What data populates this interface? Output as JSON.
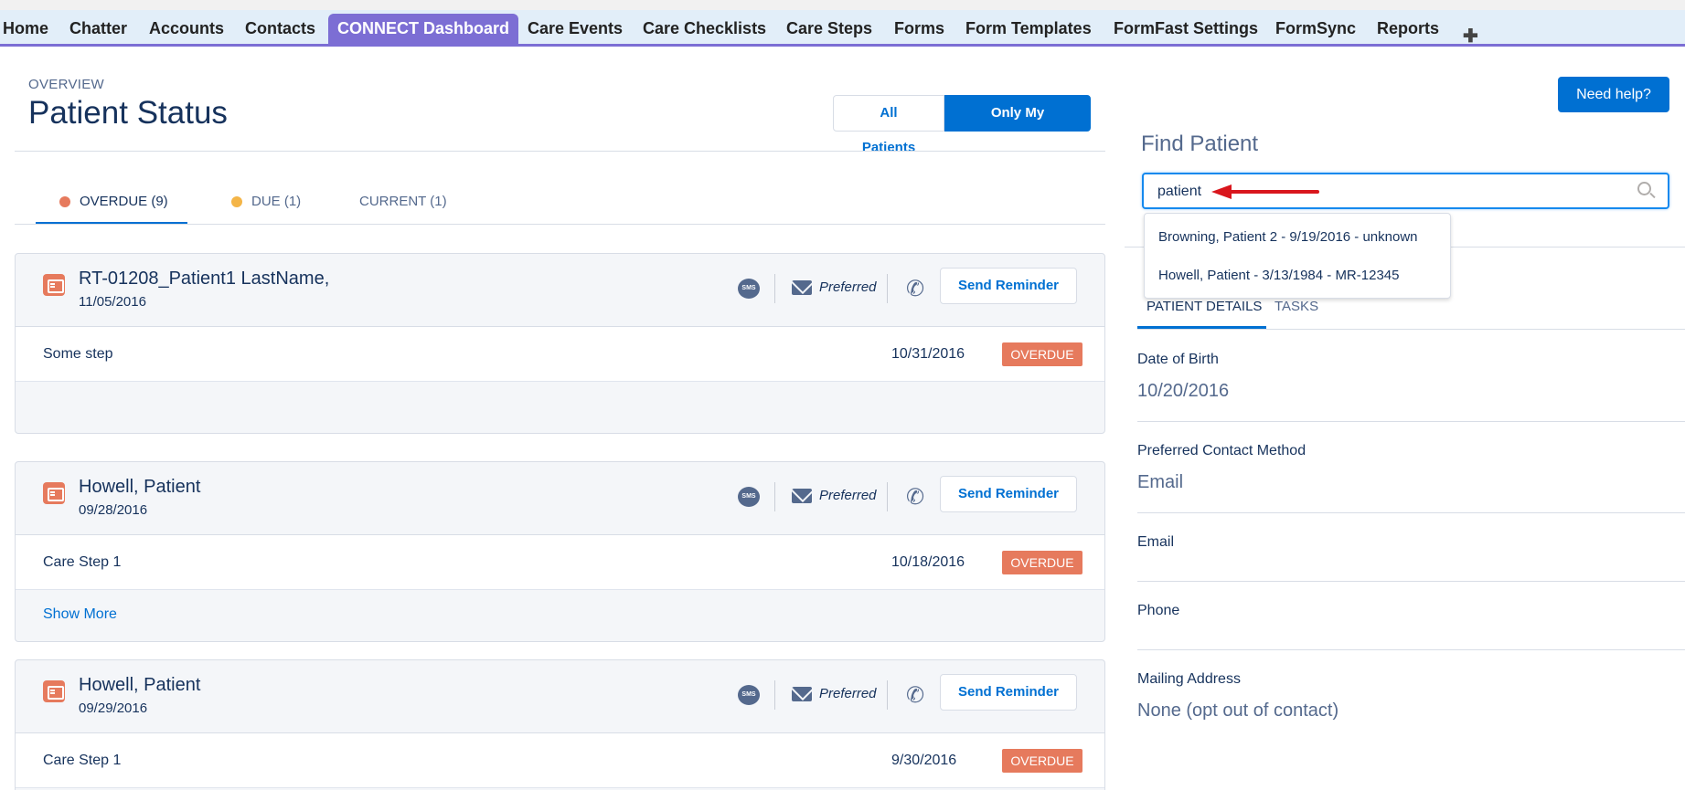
{
  "nav": {
    "tabs": [
      "Home",
      "Chatter",
      "Accounts",
      "Contacts",
      "CONNECT Dashboard",
      "Care Events",
      "Care Checklists",
      "Care Steps",
      "Forms",
      "Form Templates",
      "FormFast Settings",
      "FormSync",
      "Reports"
    ],
    "active_tab": "CONNECT Dashboard",
    "plus_icon": "plus-icon"
  },
  "header": {
    "eyebrow": "OVERVIEW",
    "title": "Patient Status",
    "filter_all": "All Patients",
    "filter_mine": "Only My Patients",
    "filter_active": "Only My Patients"
  },
  "status_tabs": {
    "overdue": "OVERDUE (9)",
    "due": "DUE (1)",
    "current": "CURRENT (1)"
  },
  "cards": [
    {
      "name": "RT-01208_Patient1 LastName,",
      "date": "11/05/2016",
      "preferred": "Preferred",
      "sms": "SMS",
      "remind": "Send Reminder",
      "step": "Some step",
      "step_date": "10/31/2016",
      "status": "OVERDUE",
      "footer": ""
    },
    {
      "name": "Howell, Patient",
      "date": "09/28/2016",
      "preferred": "Preferred",
      "sms": "SMS",
      "remind": "Send Reminder",
      "step": "Care Step 1",
      "step_date": "10/18/2016",
      "status": "OVERDUE",
      "footer": "Show More"
    },
    {
      "name": "Howell, Patient",
      "date": "09/29/2016",
      "preferred": "Preferred",
      "sms": "SMS",
      "remind": "Send Reminder",
      "step": "Care Step 1",
      "step_date": "9/30/2016",
      "status": "OVERDUE",
      "footer": ""
    }
  ],
  "right_panel": {
    "help": "Need help?",
    "find_title": "Find Patient",
    "search_value": "patient",
    "suggestions": [
      "Browning, Patient 2 - 9/19/2016 - unknown",
      "Howell, Patient - 3/13/1984 - MR-12345"
    ],
    "tabs": [
      "PATIENT DETAILS",
      "TASKS"
    ],
    "active_tab": "PATIENT DETAILS",
    "fields": [
      {
        "label": "Date of Birth",
        "value": "10/20/2016"
      },
      {
        "label": "Preferred Contact Method",
        "value": "Email"
      },
      {
        "label": "Email",
        "value": ""
      },
      {
        "label": "Phone",
        "value": ""
      },
      {
        "label": "Mailing Address",
        "value": "None (opt out of contact)"
      }
    ]
  },
  "colors": {
    "accent": "#0070d2",
    "active_tab": "#7c6ed4",
    "overdue": "#e67a5d",
    "due": "#f4b548",
    "text": "#16325c",
    "muted": "#54698d",
    "annotation_arrow": "#d9161d"
  }
}
